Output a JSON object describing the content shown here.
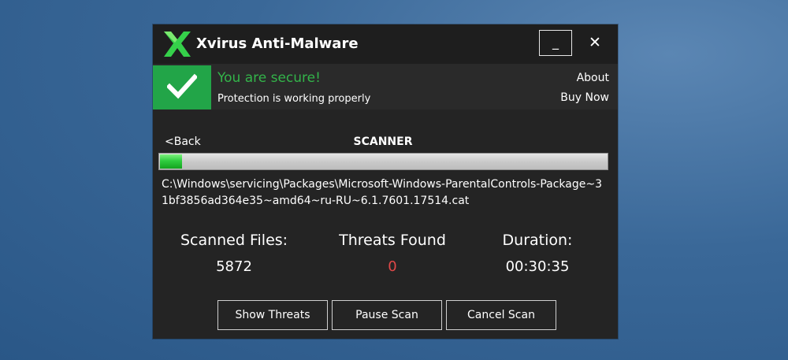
{
  "window": {
    "title": "Xvirus Anti-Malware",
    "logo_icon": "x-logo-icon",
    "minimize_label": "_",
    "close_label": "✕"
  },
  "status": {
    "title": "You are secure!",
    "subtitle": "Protection is working properly",
    "icon": "checkmark-icon",
    "about_label": "About",
    "buy_label": "Buy Now"
  },
  "scanner": {
    "back_label": "<Back",
    "title": "SCANNER",
    "progress": 0.05,
    "current_file": "C:\\Windows\\servicing\\Packages\\Microsoft-Windows-ParentalControls-Package~31bf3856ad364e35~amd64~ru-RU~6.1.7601.17514.cat"
  },
  "stats": {
    "scanned_label": "Scanned Files:",
    "scanned_value": "5872",
    "threats_label": "Threats Found",
    "threats_value": "0",
    "duration_label": "Duration:",
    "duration_value": "00:30:35"
  },
  "actions": {
    "show_threats": "Show Threats",
    "pause_scan": "Pause Scan",
    "cancel_scan": "Cancel Scan"
  },
  "colors": {
    "accent_green": "#22a548",
    "secure_text": "#33b44a",
    "threat_red": "#e04848",
    "window_bg": "#242424"
  }
}
